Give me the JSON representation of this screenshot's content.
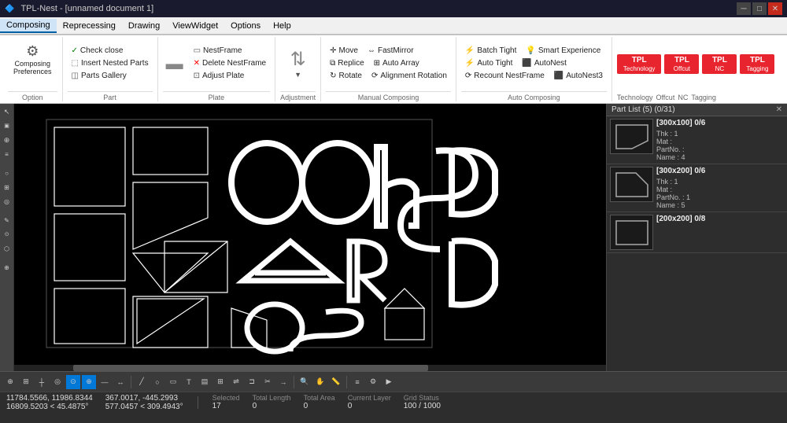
{
  "titlebar": {
    "icons": [
      "app-icon"
    ],
    "title": "TPL-Nest - [unnamed document 1]",
    "controls": [
      "minimize",
      "maximize",
      "close"
    ]
  },
  "menubar": {
    "items": [
      "Composing",
      "Reprecessing",
      "Drawing",
      "ViewWidget",
      "Options",
      "Help"
    ]
  },
  "ribbon": {
    "tabs": [
      "Composing",
      "Reprecessing",
      "Drawing",
      "ViewWidget",
      "Options",
      "Help"
    ],
    "active_tab": "Composing",
    "groups": [
      {
        "label": "Option",
        "items": [
          {
            "label": "Composing Preferences",
            "icon": "pref-icon"
          }
        ]
      },
      {
        "label": "Part",
        "items": [
          {
            "label": "Check close",
            "icon": "check-icon"
          },
          {
            "label": "Insert Nested Parts",
            "icon": "insert-icon"
          },
          {
            "label": "Parts Gallery",
            "icon": "gallery-icon"
          }
        ]
      },
      {
        "label": "Plate",
        "items": [
          {
            "label": "NestFrame",
            "icon": "nestframe-icon"
          },
          {
            "label": "Delete NestFrame",
            "icon": "delete-icon"
          },
          {
            "label": "Adjust Plate",
            "icon": "adjust-icon"
          }
        ]
      },
      {
        "label": "Adjustment",
        "dropdown_arrow": true
      },
      {
        "label": "Manual Composing",
        "items": [
          {
            "label": "Move",
            "icon": "move-icon"
          },
          {
            "label": "Replice",
            "icon": "replice-icon"
          },
          {
            "label": "Rotate",
            "icon": "rotate-icon"
          },
          {
            "label": "FastMirror",
            "icon": "fastmirror-icon"
          },
          {
            "label": "Auto Array",
            "icon": "autoarray-icon"
          },
          {
            "label": "Alignment Rotation",
            "icon": "alignrot-icon"
          }
        ]
      },
      {
        "label": "Auto Composing",
        "items": [
          {
            "label": "Batch Tight",
            "icon": "batchtight-icon"
          },
          {
            "label": "Auto Tight",
            "icon": "autotight-icon"
          },
          {
            "label": "Recount NestFrame",
            "icon": "recount-icon"
          },
          {
            "label": "Smart Experience",
            "icon": "smart-icon"
          },
          {
            "label": "AutoNest",
            "icon": "autonest-icon"
          },
          {
            "label": "AutoNest3",
            "icon": "autonest3-icon"
          }
        ]
      },
      {
        "label": "Technology",
        "tpl_color": "#e8252e",
        "text": "TPL"
      },
      {
        "label": "Offcut",
        "tpl_color": "#e8252e",
        "text": "TPL"
      },
      {
        "label": "NC",
        "tpl_color": "#e8252e",
        "text": "TPL"
      },
      {
        "label": "Tagging",
        "tpl_color": "#e8252e",
        "text": "TPL"
      }
    ]
  },
  "partlist": {
    "title": "Part List (5) (0/31)",
    "items": [
      {
        "size": "[300x100] 0/6",
        "details": "Thk : 1\nMat : \nPartNo. : \nName : 4"
      },
      {
        "size": "[300x200] 0/6",
        "details": "Thk : 1\nMat : \nPartNo. : 1\nName : 5"
      },
      {
        "size": "[200x200] 0/8",
        "details": ""
      }
    ]
  },
  "statusbar": {
    "coords1": "11784.5566, 11986.8344",
    "coords2": "16809.5203 < 45.4875°",
    "field2_1": "367.0017, -445.2993",
    "field2_2": "577.0457 < 309.4943°",
    "selected_label": "Selected",
    "selected_val": "17",
    "total_length_label": "Total Length",
    "total_length_val": "0",
    "total_area_label": "Total Area",
    "total_area_val": "0",
    "current_layer_label": "Current Layer",
    "current_layer_val": "0",
    "grid_status_label": "Grid Status",
    "grid_status_val": "100 / 1000"
  }
}
